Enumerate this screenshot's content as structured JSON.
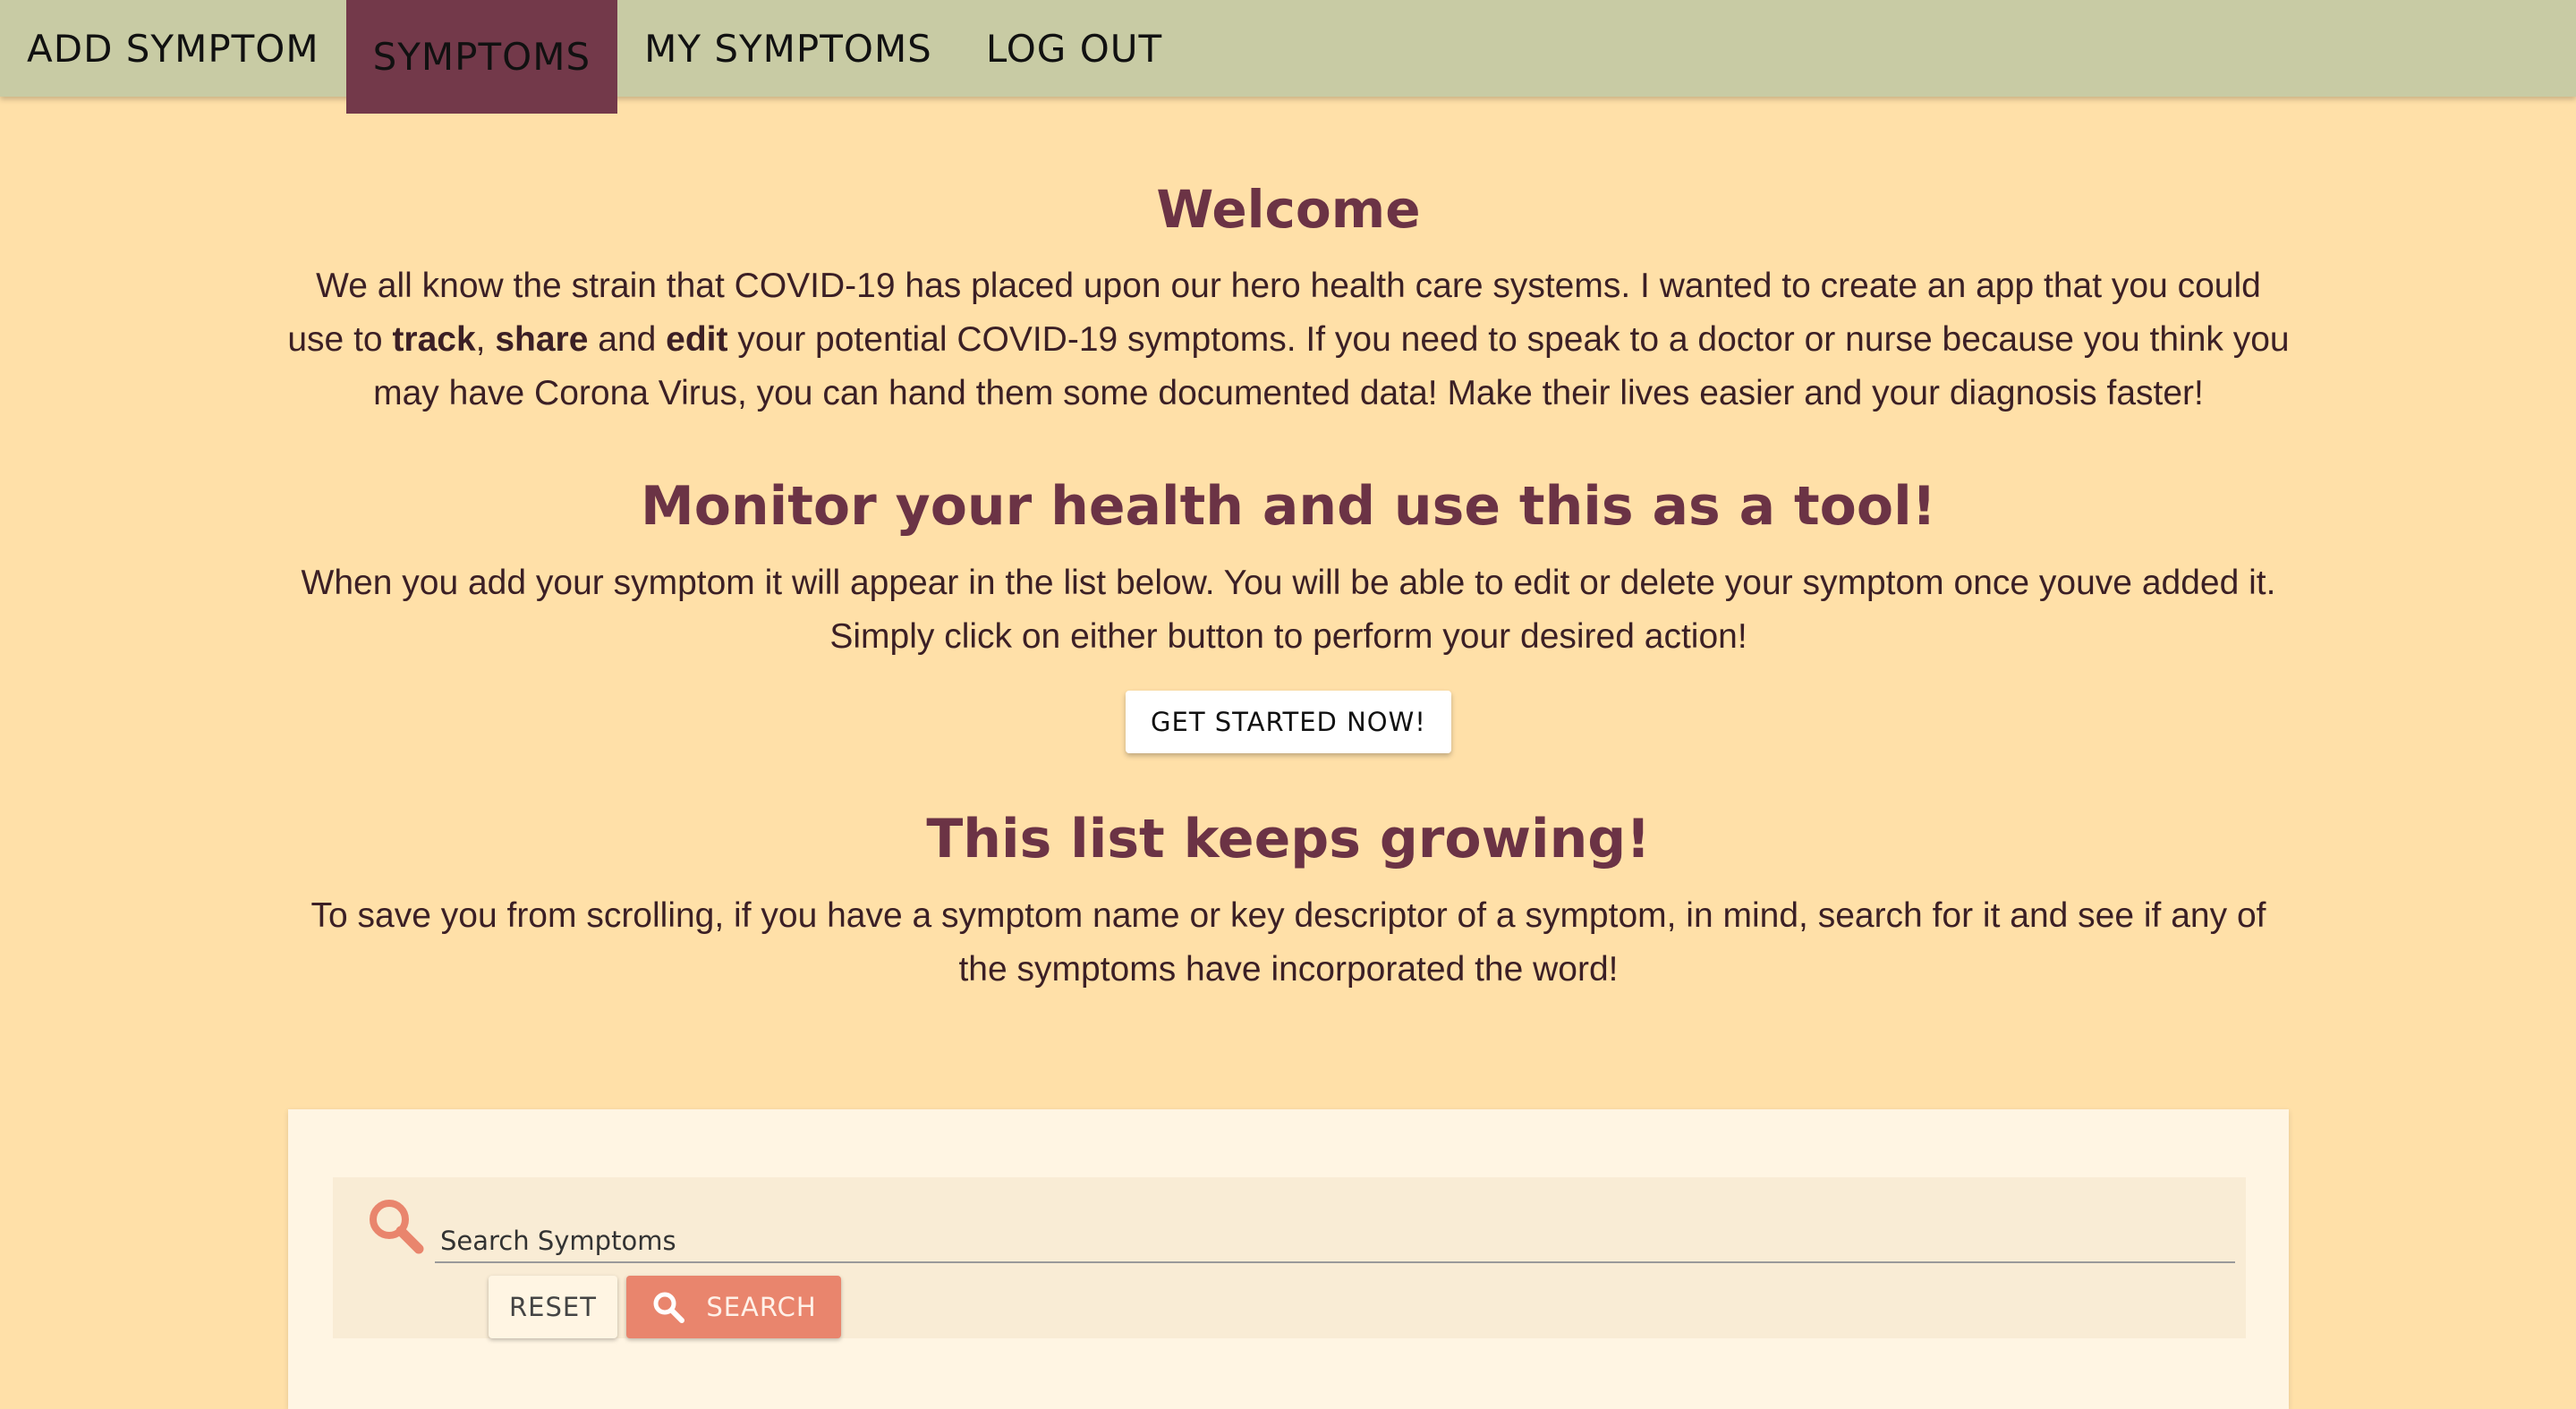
{
  "nav": {
    "items": [
      {
        "label": "ADD SYMPTOM",
        "active": false
      },
      {
        "label": "SYMPTOMS",
        "active": true
      },
      {
        "label": "MY SYMPTOMS",
        "active": false
      },
      {
        "label": "LOG OUT",
        "active": false
      }
    ],
    "bg_color": "#c8cba4",
    "active_color": "#73394a"
  },
  "welcome": {
    "title": "Welcome",
    "text_1": "We all know the strain that COVID-19 has placed upon our hero health care systems. I wanted to create an app that you could use to ",
    "bold_track": "track",
    "sep_1": ", ",
    "bold_share": "share",
    "sep_2": " and ",
    "bold_edit": "edit",
    "text_2": " your potential COVID-19 symptoms. If you need to speak to a doctor or nurse because you think you may have Corona Virus, you can hand them some documented data! Make their lives easier and your diagnosis faster!"
  },
  "monitor": {
    "title": "Monitor your health and use this as a tool!",
    "text": "When you add your symptom it will appear in the list below. You will be able to edit or delete your symptom once youve added it. Simply click on either button to perform your desired action!",
    "cta_label": "GET STARTED NOW!"
  },
  "list": {
    "title": "This list keeps growing!",
    "text": "To save you from scrolling, if you have a symptom name or key descriptor of a symptom, in mind, search for it and see if any of the symptoms have incorporated the word!"
  },
  "search": {
    "placeholder": "Search Symptoms",
    "value": "",
    "reset_label": "RESET",
    "search_label": "SEARCH",
    "icon": "search-icon",
    "accent_color": "#e9856d"
  },
  "colors": {
    "page_bg": "#ffe0a8",
    "heading": "#6b3345",
    "card_bg": "#fff5e3"
  }
}
